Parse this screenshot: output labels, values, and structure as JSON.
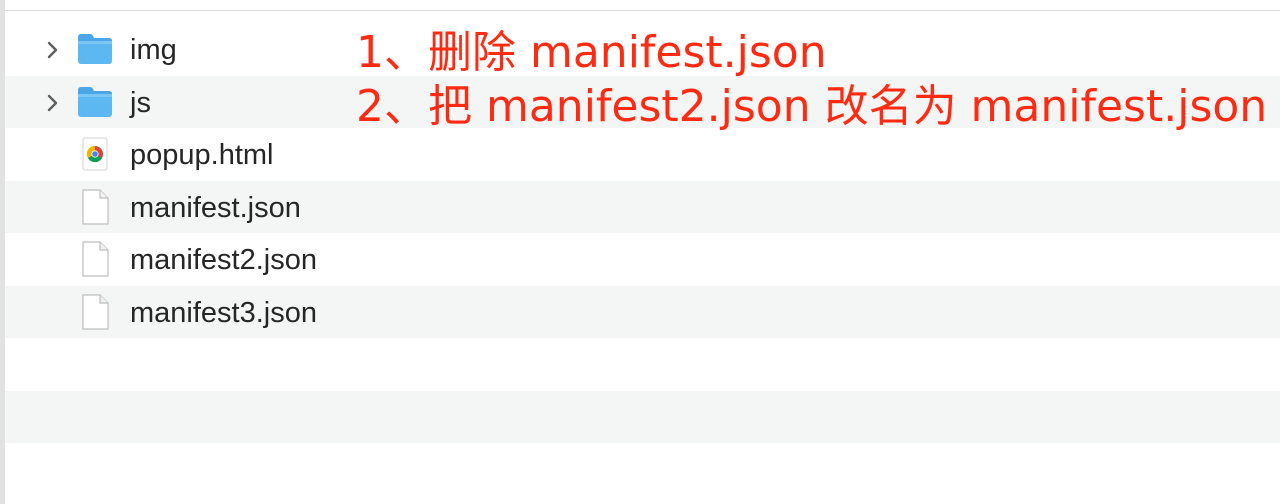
{
  "file_browser": {
    "rows": [
      {
        "name": "img",
        "type": "folder",
        "icon": "folder-icon",
        "expanded": false
      },
      {
        "name": "js",
        "type": "folder",
        "icon": "folder-icon",
        "expanded": false
      },
      {
        "name": "popup.html",
        "type": "file",
        "icon": "chrome-html-file-icon"
      },
      {
        "name": "manifest.json",
        "type": "file",
        "icon": "document-icon"
      },
      {
        "name": "manifest2.json",
        "type": "file",
        "icon": "document-icon"
      },
      {
        "name": "manifest3.json",
        "type": "file",
        "icon": "document-icon"
      }
    ]
  },
  "annotations": {
    "step1": "1、删除 manifest.json",
    "step2": "2、把 manifest2.json 改名为 manifest.json"
  },
  "colors": {
    "annotation": "#ff2a12",
    "folder": "#56b3f0",
    "row_alt": "#f4f5f5",
    "text": "#262626"
  }
}
